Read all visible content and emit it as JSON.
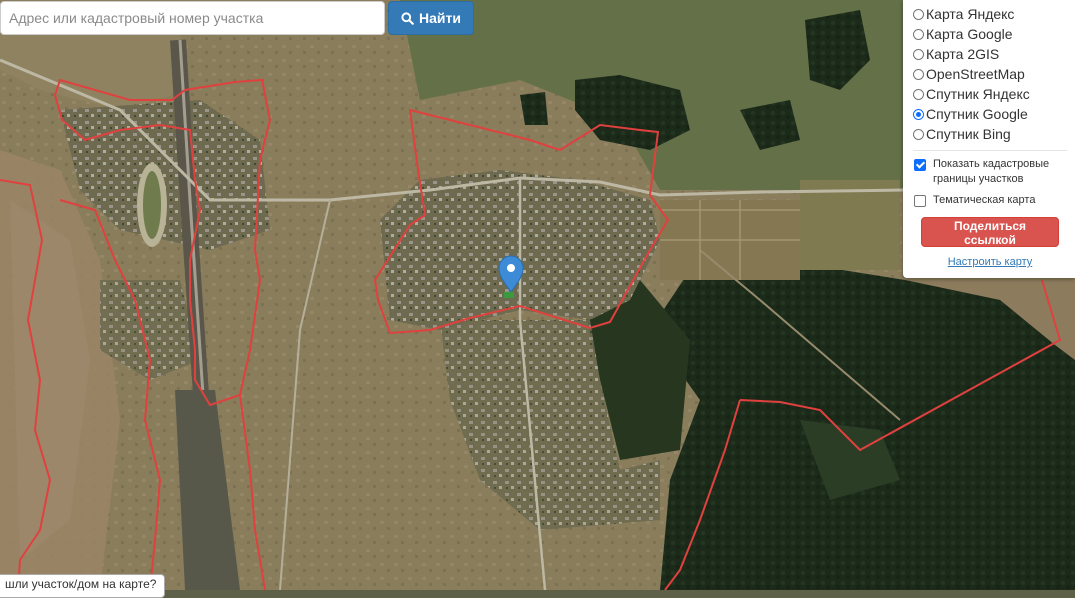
{
  "search": {
    "placeholder": "Адрес или кадастровый номер участка",
    "button_label": "Найти"
  },
  "layers": [
    {
      "label": "Карта Яндекс",
      "checked": false
    },
    {
      "label": "Карта Google",
      "checked": false
    },
    {
      "label": "Карта 2GIS",
      "checked": false
    },
    {
      "label": "OpenStreetMap",
      "checked": false
    },
    {
      "label": "Спутник Яндекс",
      "checked": false
    },
    {
      "label": "Спутник Google",
      "checked": true
    },
    {
      "label": "Спутник Bing",
      "checked": false
    }
  ],
  "options": {
    "cadastral_label": "Показать кадастровые границы участков",
    "cadastral_checked": true,
    "thematic_label": "Тематическая карта",
    "thematic_checked": false
  },
  "share_label": "Поделиться ссылкой",
  "configure_label": "Настроить карту",
  "hint": "шли участок/дом на карте?",
  "colors": {
    "boundary": "#e0413f",
    "search_button": "#337ab7",
    "share_button": "#d9534f",
    "marker": "#3d8bd6"
  }
}
